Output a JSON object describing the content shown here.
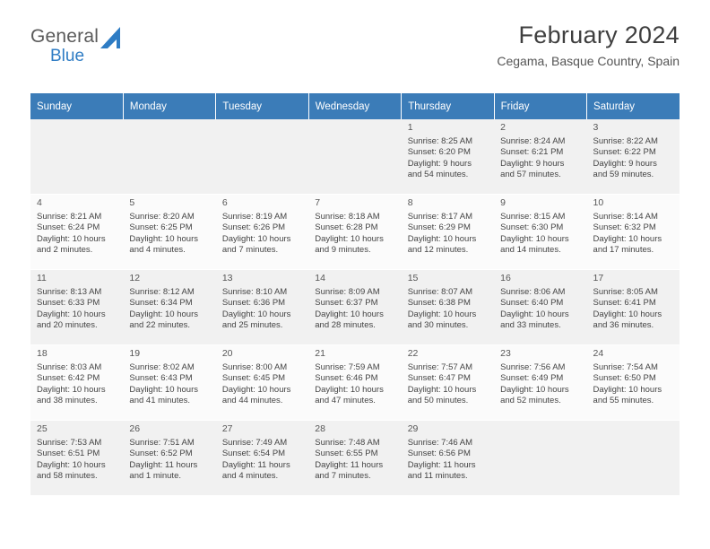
{
  "brand": {
    "name_top": "General",
    "name_bottom": "Blue",
    "accent": "#2e7cc4"
  },
  "header": {
    "title": "February 2024",
    "subtitle": "Cegama, Basque Country, Spain"
  },
  "theme": {
    "header_row_bg": "#3b7cb8",
    "odd_row_bg": "#f1f1f1",
    "even_row_bg": "#fbfbfb"
  },
  "weekdays": [
    "Sunday",
    "Monday",
    "Tuesday",
    "Wednesday",
    "Thursday",
    "Friday",
    "Saturday"
  ],
  "weeks": [
    [
      {
        "day": "",
        "lines": []
      },
      {
        "day": "",
        "lines": []
      },
      {
        "day": "",
        "lines": []
      },
      {
        "day": "",
        "lines": []
      },
      {
        "day": "1",
        "lines": [
          "Sunrise: 8:25 AM",
          "Sunset: 6:20 PM",
          "Daylight: 9 hours",
          "and 54 minutes."
        ]
      },
      {
        "day": "2",
        "lines": [
          "Sunrise: 8:24 AM",
          "Sunset: 6:21 PM",
          "Daylight: 9 hours",
          "and 57 minutes."
        ]
      },
      {
        "day": "3",
        "lines": [
          "Sunrise: 8:22 AM",
          "Sunset: 6:22 PM",
          "Daylight: 9 hours",
          "and 59 minutes."
        ]
      }
    ],
    [
      {
        "day": "4",
        "lines": [
          "Sunrise: 8:21 AM",
          "Sunset: 6:24 PM",
          "Daylight: 10 hours",
          "and 2 minutes."
        ]
      },
      {
        "day": "5",
        "lines": [
          "Sunrise: 8:20 AM",
          "Sunset: 6:25 PM",
          "Daylight: 10 hours",
          "and 4 minutes."
        ]
      },
      {
        "day": "6",
        "lines": [
          "Sunrise: 8:19 AM",
          "Sunset: 6:26 PM",
          "Daylight: 10 hours",
          "and 7 minutes."
        ]
      },
      {
        "day": "7",
        "lines": [
          "Sunrise: 8:18 AM",
          "Sunset: 6:28 PM",
          "Daylight: 10 hours",
          "and 9 minutes."
        ]
      },
      {
        "day": "8",
        "lines": [
          "Sunrise: 8:17 AM",
          "Sunset: 6:29 PM",
          "Daylight: 10 hours",
          "and 12 minutes."
        ]
      },
      {
        "day": "9",
        "lines": [
          "Sunrise: 8:15 AM",
          "Sunset: 6:30 PM",
          "Daylight: 10 hours",
          "and 14 minutes."
        ]
      },
      {
        "day": "10",
        "lines": [
          "Sunrise: 8:14 AM",
          "Sunset: 6:32 PM",
          "Daylight: 10 hours",
          "and 17 minutes."
        ]
      }
    ],
    [
      {
        "day": "11",
        "lines": [
          "Sunrise: 8:13 AM",
          "Sunset: 6:33 PM",
          "Daylight: 10 hours",
          "and 20 minutes."
        ]
      },
      {
        "day": "12",
        "lines": [
          "Sunrise: 8:12 AM",
          "Sunset: 6:34 PM",
          "Daylight: 10 hours",
          "and 22 minutes."
        ]
      },
      {
        "day": "13",
        "lines": [
          "Sunrise: 8:10 AM",
          "Sunset: 6:36 PM",
          "Daylight: 10 hours",
          "and 25 minutes."
        ]
      },
      {
        "day": "14",
        "lines": [
          "Sunrise: 8:09 AM",
          "Sunset: 6:37 PM",
          "Daylight: 10 hours",
          "and 28 minutes."
        ]
      },
      {
        "day": "15",
        "lines": [
          "Sunrise: 8:07 AM",
          "Sunset: 6:38 PM",
          "Daylight: 10 hours",
          "and 30 minutes."
        ]
      },
      {
        "day": "16",
        "lines": [
          "Sunrise: 8:06 AM",
          "Sunset: 6:40 PM",
          "Daylight: 10 hours",
          "and 33 minutes."
        ]
      },
      {
        "day": "17",
        "lines": [
          "Sunrise: 8:05 AM",
          "Sunset: 6:41 PM",
          "Daylight: 10 hours",
          "and 36 minutes."
        ]
      }
    ],
    [
      {
        "day": "18",
        "lines": [
          "Sunrise: 8:03 AM",
          "Sunset: 6:42 PM",
          "Daylight: 10 hours",
          "and 38 minutes."
        ]
      },
      {
        "day": "19",
        "lines": [
          "Sunrise: 8:02 AM",
          "Sunset: 6:43 PM",
          "Daylight: 10 hours",
          "and 41 minutes."
        ]
      },
      {
        "day": "20",
        "lines": [
          "Sunrise: 8:00 AM",
          "Sunset: 6:45 PM",
          "Daylight: 10 hours",
          "and 44 minutes."
        ]
      },
      {
        "day": "21",
        "lines": [
          "Sunrise: 7:59 AM",
          "Sunset: 6:46 PM",
          "Daylight: 10 hours",
          "and 47 minutes."
        ]
      },
      {
        "day": "22",
        "lines": [
          "Sunrise: 7:57 AM",
          "Sunset: 6:47 PM",
          "Daylight: 10 hours",
          "and 50 minutes."
        ]
      },
      {
        "day": "23",
        "lines": [
          "Sunrise: 7:56 AM",
          "Sunset: 6:49 PM",
          "Daylight: 10 hours",
          "and 52 minutes."
        ]
      },
      {
        "day": "24",
        "lines": [
          "Sunrise: 7:54 AM",
          "Sunset: 6:50 PM",
          "Daylight: 10 hours",
          "and 55 minutes."
        ]
      }
    ],
    [
      {
        "day": "25",
        "lines": [
          "Sunrise: 7:53 AM",
          "Sunset: 6:51 PM",
          "Daylight: 10 hours",
          "and 58 minutes."
        ]
      },
      {
        "day": "26",
        "lines": [
          "Sunrise: 7:51 AM",
          "Sunset: 6:52 PM",
          "Daylight: 11 hours",
          "and 1 minute."
        ]
      },
      {
        "day": "27",
        "lines": [
          "Sunrise: 7:49 AM",
          "Sunset: 6:54 PM",
          "Daylight: 11 hours",
          "and 4 minutes."
        ]
      },
      {
        "day": "28",
        "lines": [
          "Sunrise: 7:48 AM",
          "Sunset: 6:55 PM",
          "Daylight: 11 hours",
          "and 7 minutes."
        ]
      },
      {
        "day": "29",
        "lines": [
          "Sunrise: 7:46 AM",
          "Sunset: 6:56 PM",
          "Daylight: 11 hours",
          "and 11 minutes."
        ]
      },
      {
        "day": "",
        "lines": []
      },
      {
        "day": "",
        "lines": []
      }
    ]
  ]
}
